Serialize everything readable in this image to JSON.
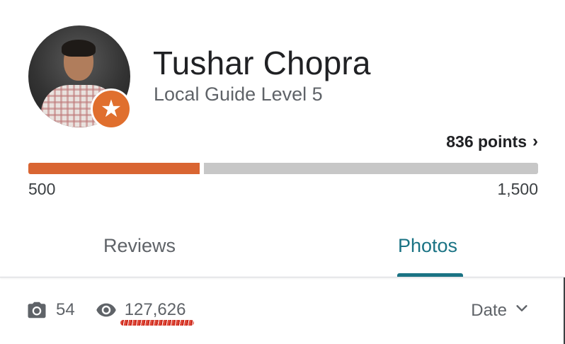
{
  "profile": {
    "name": "Tushar Chopra",
    "level": "Local Guide Level 5",
    "badge_icon": "star-icon"
  },
  "points": {
    "label": "836 points",
    "chevron": "›"
  },
  "progress": {
    "min_label": "500",
    "max_label": "1,500",
    "fraction": 0.336,
    "fill_color": "#d96532",
    "track_color": "#c7c7c7"
  },
  "tabs": [
    {
      "label": "Reviews",
      "active": false
    },
    {
      "label": "Photos",
      "active": true
    }
  ],
  "stats": {
    "photo_count": "54",
    "view_count": "127,626"
  },
  "sort": {
    "label": "Date"
  },
  "colors": {
    "accent": "#1a7384",
    "badge": "#e06f2e"
  }
}
